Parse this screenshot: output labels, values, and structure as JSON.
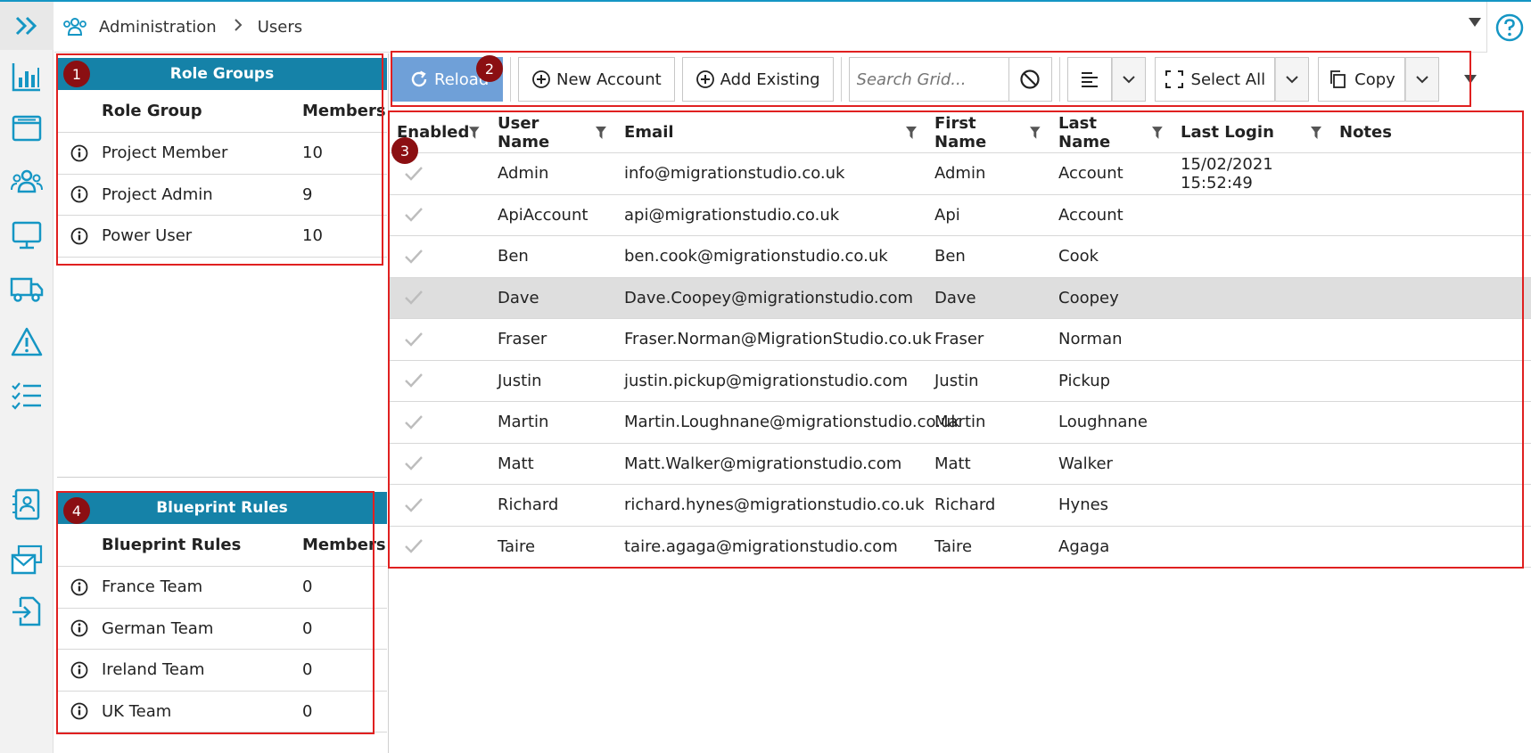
{
  "breadcrumb": {
    "section": "Administration",
    "page": "Users"
  },
  "role_groups": {
    "title": "Role Groups",
    "col_name": "Role Group",
    "col_members": "Members",
    "rows": [
      {
        "name": "Project Member",
        "members": "10"
      },
      {
        "name": "Project Admin",
        "members": "9"
      },
      {
        "name": "Power User",
        "members": "10"
      }
    ]
  },
  "blueprint_rules": {
    "title": "Blueprint Rules",
    "col_name": "Blueprint Rules",
    "col_members": "Members",
    "rows": [
      {
        "name": "France Team",
        "members": "0"
      },
      {
        "name": "German Team",
        "members": "0"
      },
      {
        "name": "Ireland Team",
        "members": "0"
      },
      {
        "name": "UK Team",
        "members": "0"
      }
    ]
  },
  "toolbar": {
    "reload": "Reload",
    "new_account": "New Account",
    "add_existing": "Add Existing",
    "search_placeholder": "Search Grid...",
    "select_all": "Select All",
    "copy": "Copy"
  },
  "grid": {
    "columns": {
      "enabled": "Enabled",
      "user_name": "User Name",
      "email": "Email",
      "first_name": "First Name",
      "last_name": "Last Name",
      "last_login": "Last Login",
      "notes": "Notes"
    },
    "rows": [
      {
        "user": "Admin",
        "email": "info@migrationstudio.co.uk",
        "first": "Admin",
        "last": "Account",
        "login": "15/02/2021 15:52:49",
        "notes": ""
      },
      {
        "user": "ApiAccount",
        "email": "api@migrationstudio.co.uk",
        "first": "Api",
        "last": "Account",
        "login": "",
        "notes": ""
      },
      {
        "user": "Ben",
        "email": "ben.cook@migrationstudio.co.uk",
        "first": "Ben",
        "last": "Cook",
        "login": "",
        "notes": ""
      },
      {
        "user": "Dave",
        "email": "Dave.Coopey@migrationstudio.com",
        "first": "Dave",
        "last": "Coopey",
        "login": "",
        "notes": ""
      },
      {
        "user": "Fraser",
        "email": "Fraser.Norman@MigrationStudio.co.uk",
        "first": "Fraser",
        "last": "Norman",
        "login": "",
        "notes": ""
      },
      {
        "user": "Justin",
        "email": "justin.pickup@migrationstudio.com",
        "first": "Justin",
        "last": "Pickup",
        "login": "",
        "notes": ""
      },
      {
        "user": "Martin",
        "email": "Martin.Loughnane@migrationstudio.co.uk",
        "first": "Martin",
        "last": "Loughnane",
        "login": "",
        "notes": ""
      },
      {
        "user": "Matt",
        "email": "Matt.Walker@migrationstudio.com",
        "first": "Matt",
        "last": "Walker",
        "login": "",
        "notes": ""
      },
      {
        "user": "Richard",
        "email": "richard.hynes@migrationstudio.co.uk",
        "first": "Richard",
        "last": "Hynes",
        "login": "",
        "notes": ""
      },
      {
        "user": "Taire",
        "email": "taire.agaga@migrationstudio.com",
        "first": "Taire",
        "last": "Agaga",
        "login": "",
        "notes": ""
      }
    ],
    "selected_user": "Dave"
  },
  "markers": [
    "1",
    "2",
    "3",
    "4"
  ],
  "colors": {
    "accent": "#1596c4",
    "panel_header": "#1582a8",
    "reload": "#6fa0d8",
    "annotation": "#e02020",
    "marker": "#8b0f12"
  }
}
